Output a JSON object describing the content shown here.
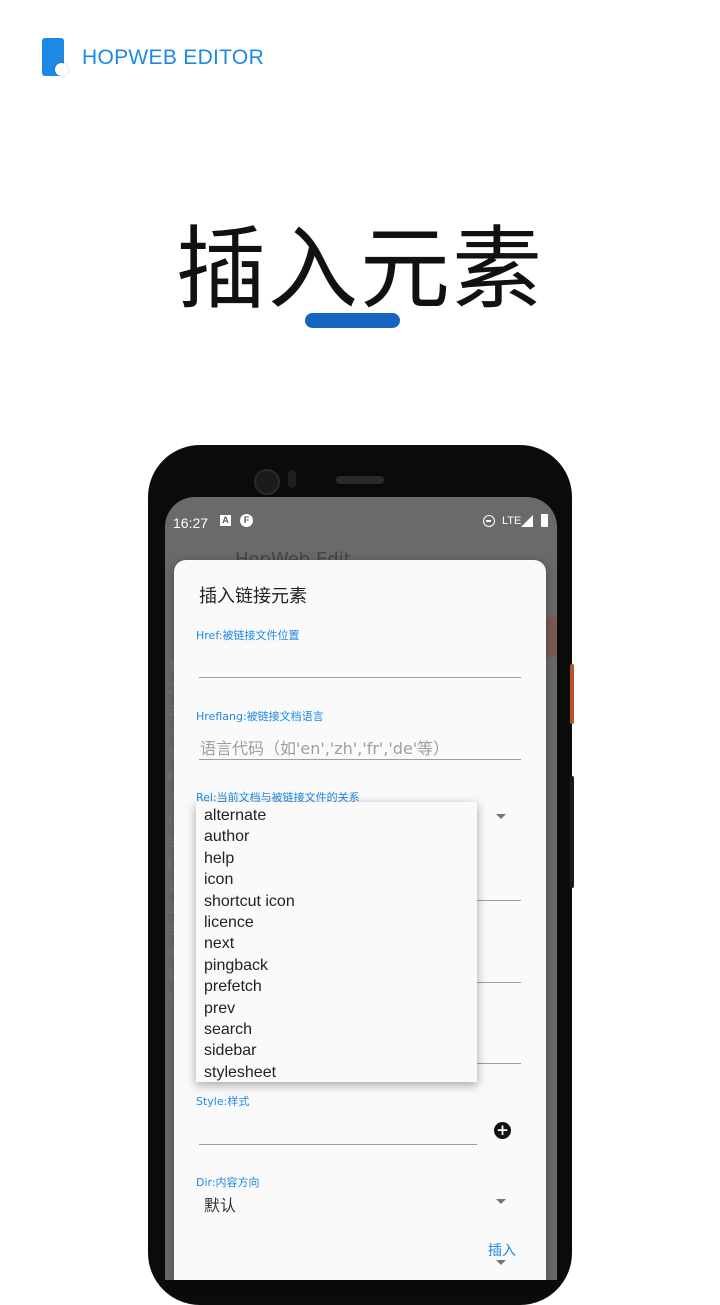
{
  "brand": {
    "name": "HOPWEB EDITOR"
  },
  "hero": {
    "title": "插入元素"
  },
  "status_bar": {
    "time": "16:27",
    "network": "LTE"
  },
  "background_app": {
    "title": "HopWeb Edit",
    "line_numbers": [
      "1",
      "2",
      "3",
      "4",
      "5",
      "6",
      "7",
      "8",
      "9",
      "0",
      "1",
      "2",
      "3",
      "4",
      "5",
      "6"
    ]
  },
  "dialog": {
    "title": "插入链接元素",
    "href": {
      "label": "Href:被链接文件位置",
      "value": ""
    },
    "hreflang": {
      "label": "Hreflang:被链接文档语言",
      "placeholder": "语言代码（如'en','zh','fr','de'等）"
    },
    "rel": {
      "label": "Rel:当前文档与被链接文件的关系",
      "options": [
        "alternate",
        "author",
        "help",
        "icon",
        "shortcut icon",
        "licence",
        "next",
        "pingback",
        "prefetch",
        "prev",
        "search",
        "sidebar",
        "stylesheet"
      ]
    },
    "style": {
      "label": "Style:样式",
      "value": ""
    },
    "dir": {
      "label": "Dir:内容方向",
      "value": "默认"
    },
    "insert_label": "插入"
  },
  "colors": {
    "accent": "#1e88e5",
    "underline": "#1565c0",
    "phone_body": "#0b0b0b",
    "scrim": "#6a6a6a"
  }
}
